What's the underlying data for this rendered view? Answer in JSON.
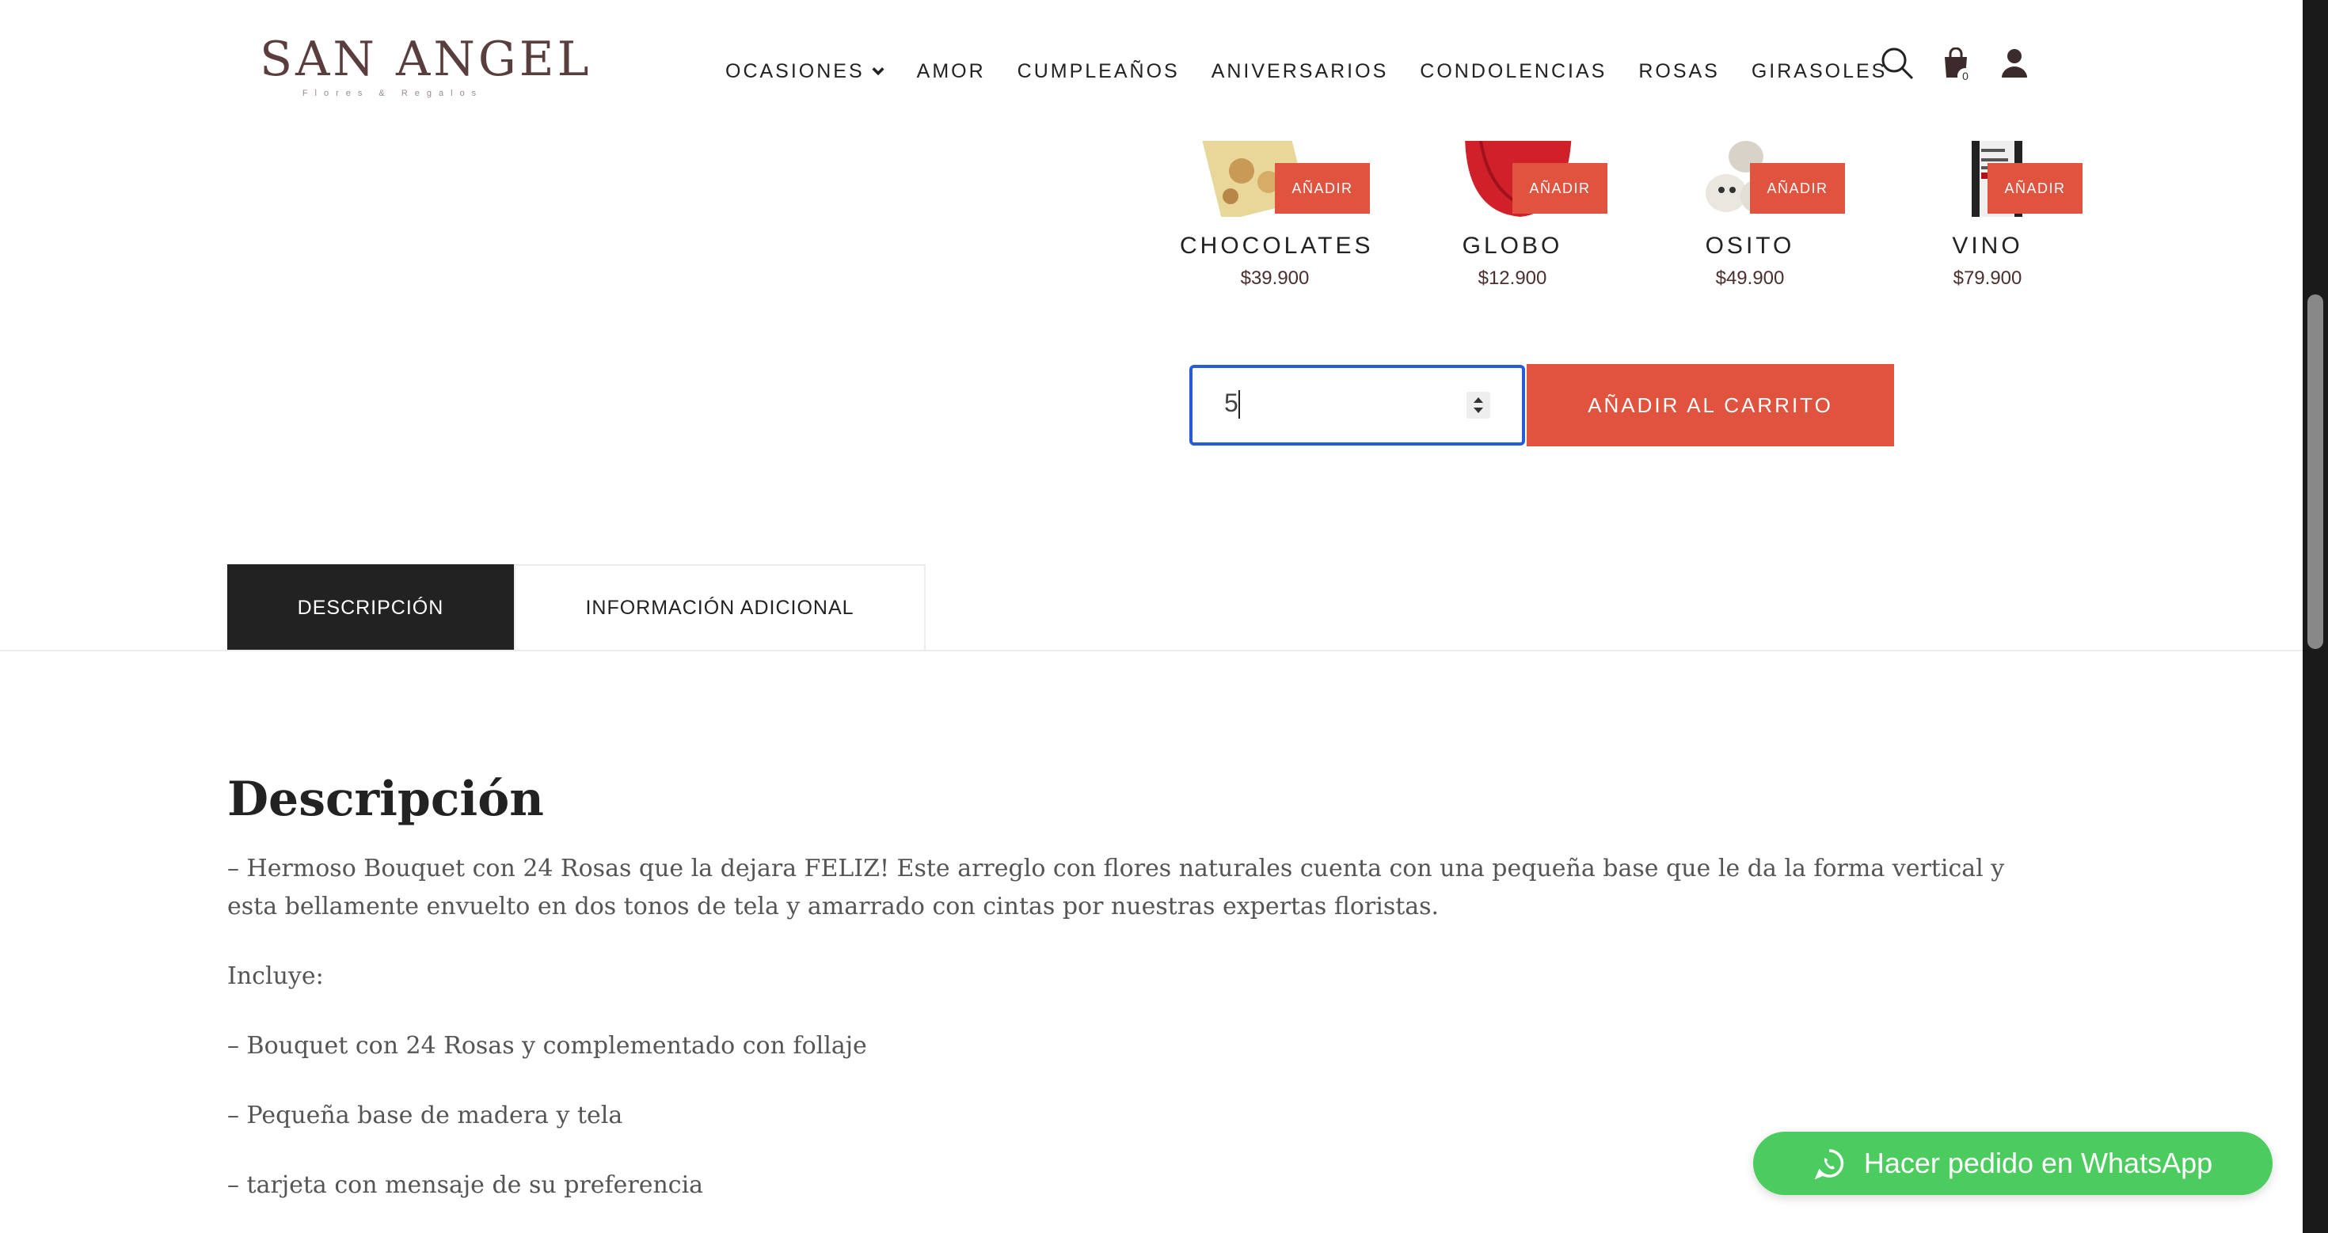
{
  "brand": {
    "name": "SAN ANGEL",
    "tagline": "Flores & Regalos"
  },
  "nav": {
    "items": [
      "OCASIONES",
      "AMOR",
      "CUMPLEAÑOS",
      "ANIVERSARIOS",
      "CONDOLENCIAS",
      "ROSAS",
      "GIRASOLES"
    ],
    "cart_count": "0"
  },
  "addons": [
    {
      "name": "CHOCOLATES",
      "price": "$39.900",
      "button": "AÑADIR"
    },
    {
      "name": "GLOBO",
      "price": "$12.900",
      "button": "AÑADIR"
    },
    {
      "name": "OSITO",
      "price": "$49.900",
      "button": "AÑADIR"
    },
    {
      "name": "VINO",
      "price": "$79.900",
      "button": "AÑADIR"
    }
  ],
  "quantity": {
    "value": "5"
  },
  "add_to_cart": "AÑADIR AL CARRITO",
  "tabs": [
    "DESCRIPCIÓN",
    "INFORMACIÓN ADICIONAL"
  ],
  "description": {
    "title": "Descripción",
    "paragraphs": [
      "– Hermoso Bouquet con 24 Rosas que la dejara FELIZ! Este arreglo con flores naturales cuenta con una pequeña base que le da la forma vertical y esta bellamente envuelto en dos tonos de tela y amarrado con cintas por nuestras expertas floristas.",
      "Incluye:",
      "– Bouquet con 24 Rosas y complementado con follaje",
      "– Pequeña base de madera y tela",
      "– tarjeta con mensaje de su preferencia"
    ]
  },
  "whatsapp": {
    "label": "Hacer pedido en WhatsApp"
  },
  "colors": {
    "accent": "#e0533f",
    "brand": "#5a3e3e",
    "whatsapp": "#4ccc5f",
    "focus": "#2a5bd7"
  },
  "icons": [
    "search-icon",
    "cart-icon",
    "user-icon",
    "chevron-down-icon",
    "whatsapp-icon"
  ]
}
